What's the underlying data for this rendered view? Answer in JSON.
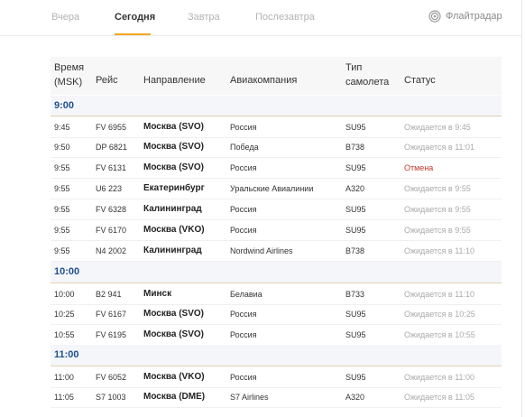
{
  "tabs": [
    {
      "label": "Вчера",
      "active": false
    },
    {
      "label": "Сегодня",
      "active": true
    },
    {
      "label": "Завтра",
      "active": false
    },
    {
      "label": "Послезавтра",
      "active": false
    }
  ],
  "brand": {
    "label": "Флайтрадар",
    "icon": "radar-icon"
  },
  "headers": {
    "time_line1": "Время",
    "time_line2": "(MSK)",
    "flight": "Рейс",
    "direction": "Направление",
    "airline": "Авиакомпания",
    "aircraft_line1": "Тип",
    "aircraft_line2": "самолета",
    "status": "Статус"
  },
  "groups": [
    {
      "hour": "9:00",
      "flights": [
        {
          "time": "9:45",
          "flight": "FV 6955",
          "dest": "Москва (SVO)",
          "airline": "Россия",
          "aircraft": "SU95",
          "status": "Ожидается в 9:45",
          "cancelled": false
        },
        {
          "time": "9:50",
          "flight": "DP 6821",
          "dest": "Москва (SVO)",
          "airline": "Победа",
          "aircraft": "B738",
          "status": "Ожидается в 11:01",
          "cancelled": false
        },
        {
          "time": "9:55",
          "flight": "FV 6131",
          "dest": "Москва (SVO)",
          "airline": "Россия",
          "aircraft": "SU95",
          "status": "Отмена",
          "cancelled": true
        },
        {
          "time": "9:55",
          "flight": "U6 223",
          "dest": "Екатеринбург",
          "airline": "Уральские Авиалинии",
          "aircraft": "A320",
          "status": "Ожидается в 9:55",
          "cancelled": false
        },
        {
          "time": "9:55",
          "flight": "FV 6328",
          "dest": "Калининград",
          "airline": "Россия",
          "aircraft": "SU95",
          "status": "Ожидается в 9:55",
          "cancelled": false
        },
        {
          "time": "9:55",
          "flight": "FV 6170",
          "dest": "Москва (VKO)",
          "airline": "Россия",
          "aircraft": "SU95",
          "status": "Ожидается в 9:55",
          "cancelled": false
        },
        {
          "time": "9:55",
          "flight": "N4 2002",
          "dest": "Калининград",
          "airline": "Nordwind Airlines",
          "aircraft": "B738",
          "status": "Ожидается в 11:10",
          "cancelled": false
        }
      ]
    },
    {
      "hour": "10:00",
      "flights": [
        {
          "time": "10:00",
          "flight": "B2 941",
          "dest": "Минск",
          "airline": "Белавиа",
          "aircraft": "B733",
          "status": "Ожидается в 11:10",
          "cancelled": false
        },
        {
          "time": "10:25",
          "flight": "FV 6167",
          "dest": "Москва (SVO)",
          "airline": "Россия",
          "aircraft": "SU95",
          "status": "Ожидается в 10:25",
          "cancelled": false
        },
        {
          "time": "10:55",
          "flight": "FV 6195",
          "dest": "Москва (SVO)",
          "airline": "Россия",
          "aircraft": "SU95",
          "status": "Ожидается в 10:55",
          "cancelled": false
        }
      ]
    },
    {
      "hour": "11:00",
      "flights": [
        {
          "time": "11:00",
          "flight": "FV 6052",
          "dest": "Москва (VKO)",
          "airline": "Россия",
          "aircraft": "SU95",
          "status": "Ожидается в 11:00",
          "cancelled": false
        },
        {
          "time": "11:05",
          "flight": "S7 1003",
          "dest": "Москва (DME)",
          "airline": "S7 Airlines",
          "aircraft": "A320",
          "status": "Ожидается в 11:05",
          "cancelled": false
        }
      ]
    }
  ],
  "colors": {
    "accent": "#f5a623",
    "hour": "#1f4f8f",
    "cancel": "#c0392b",
    "muted": "#aaaaaa"
  }
}
